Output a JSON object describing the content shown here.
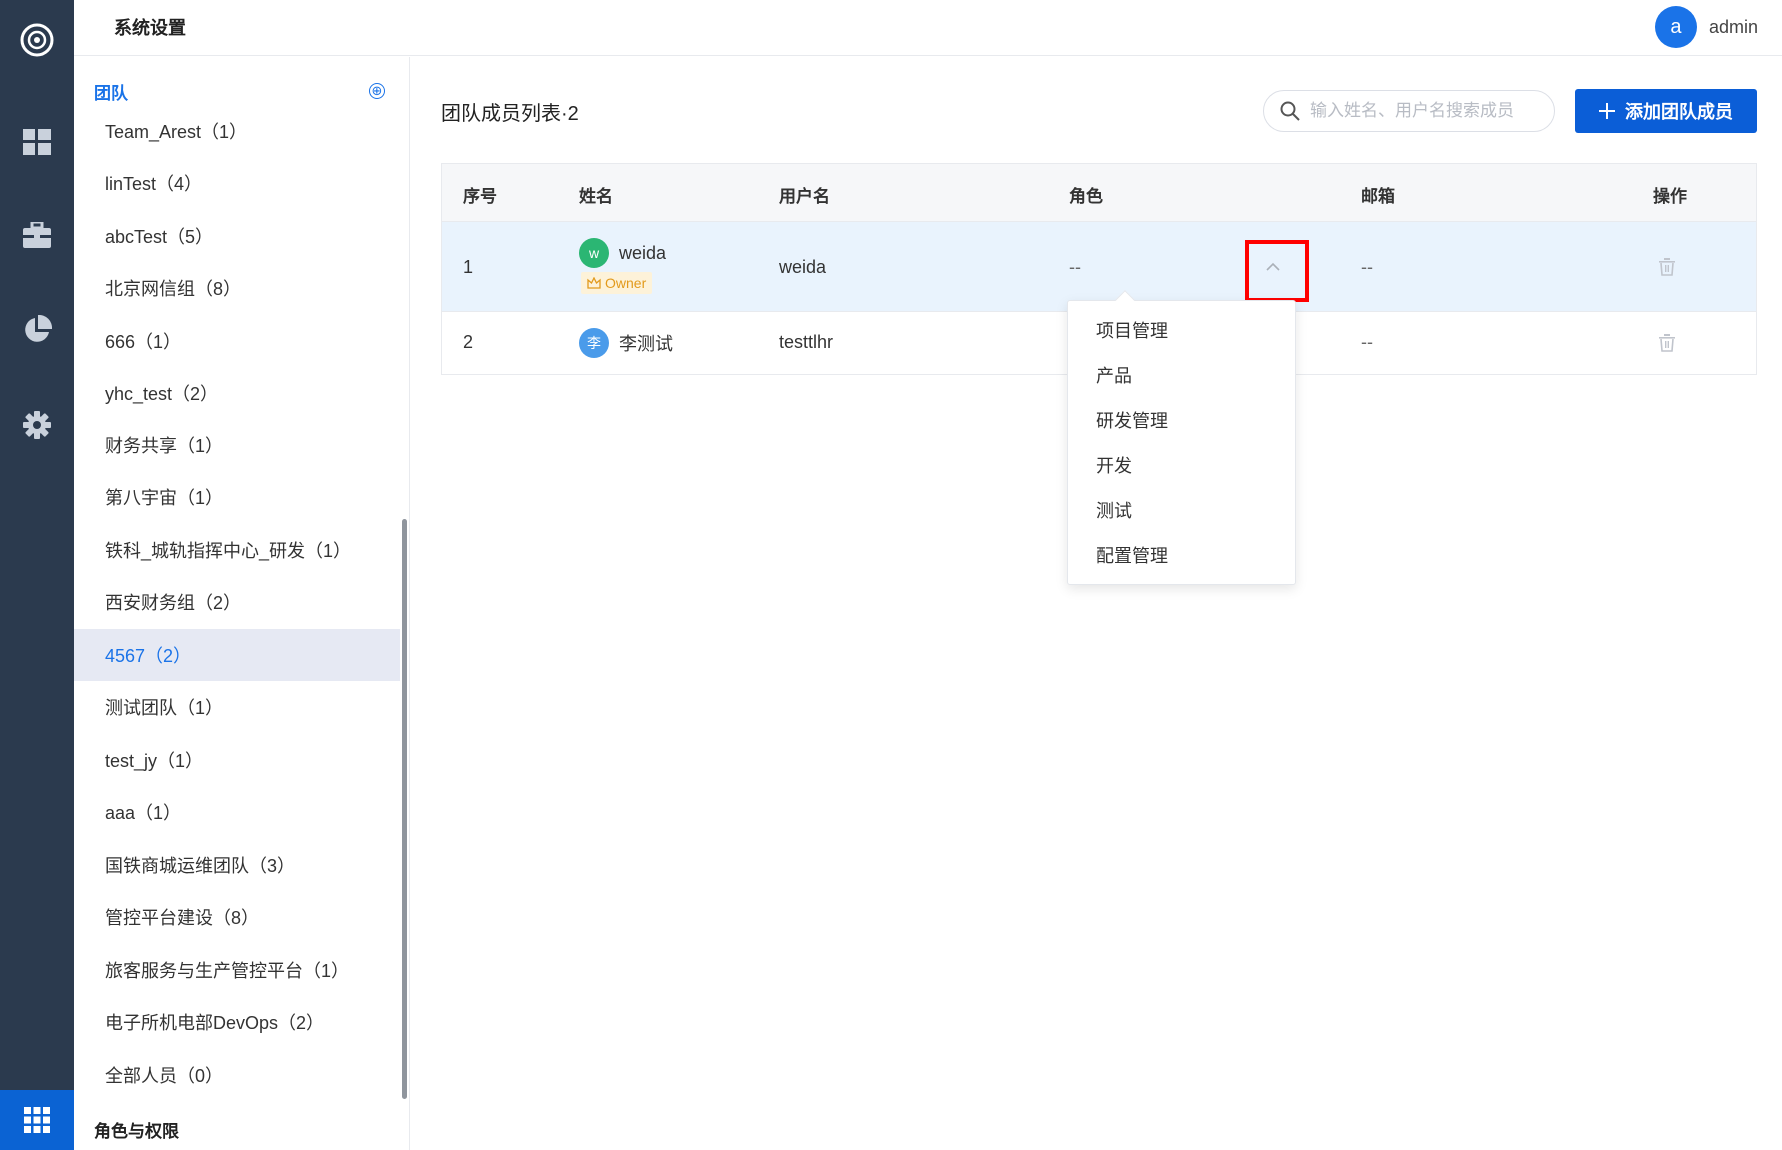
{
  "header": {
    "title": "系统设置"
  },
  "user": {
    "avatar_letter": "a",
    "name": "admin"
  },
  "rail": {
    "icons": [
      "logo-icon",
      "dashboard-icon",
      "toolbox-icon",
      "pie-chart-icon",
      "settings-icon",
      "apps-grid-icon"
    ]
  },
  "sidebar": {
    "section_title": "团队",
    "add_label": "⊕",
    "teams": [
      "Team_Arest（1）",
      "linTest（4）",
      "abcTest（5）",
      "北京网信组（8）",
      "666（1）",
      "yhc_test（2）",
      "财务共享（1）",
      "第八宇宙（1）",
      "铁科_城轨指挥中心_研发（1）",
      "西安财务组（2）",
      "4567（2）",
      "测试团队（1）",
      "test_jy（1）",
      "aaa（1）",
      "国铁商城运维团队（3）",
      "管控平台建设（8）",
      "旅客服务与生产管控平台（1）",
      "电子所机电部DevOps（2）",
      "全部人员（0）"
    ],
    "active_team": "4567（2）",
    "section2_title": "角色与权限"
  },
  "main": {
    "list_title": "团队成员列表·2",
    "search_placeholder": "输入姓名、用户名搜索成员",
    "add_button": "添加团队成员",
    "columns": [
      "序号",
      "姓名",
      "用户名",
      "角色",
      "邮箱",
      "操作"
    ],
    "rows": [
      {
        "index": "1",
        "avatar": "w",
        "name": "weida",
        "badge": "Owner",
        "username": "weida",
        "role": "--",
        "email": "--"
      },
      {
        "index": "2",
        "avatar": "李",
        "name": "李测试",
        "badge": "",
        "username": "testtlhr",
        "role": "",
        "email": "--"
      }
    ],
    "role_options": [
      "项目管理",
      "产品",
      "研发管理",
      "开发",
      "测试",
      "配置管理"
    ]
  },
  "colors": {
    "accent": "#0b5ed7",
    "rail": "#2b3a4e",
    "highlight": "#ff0000"
  }
}
